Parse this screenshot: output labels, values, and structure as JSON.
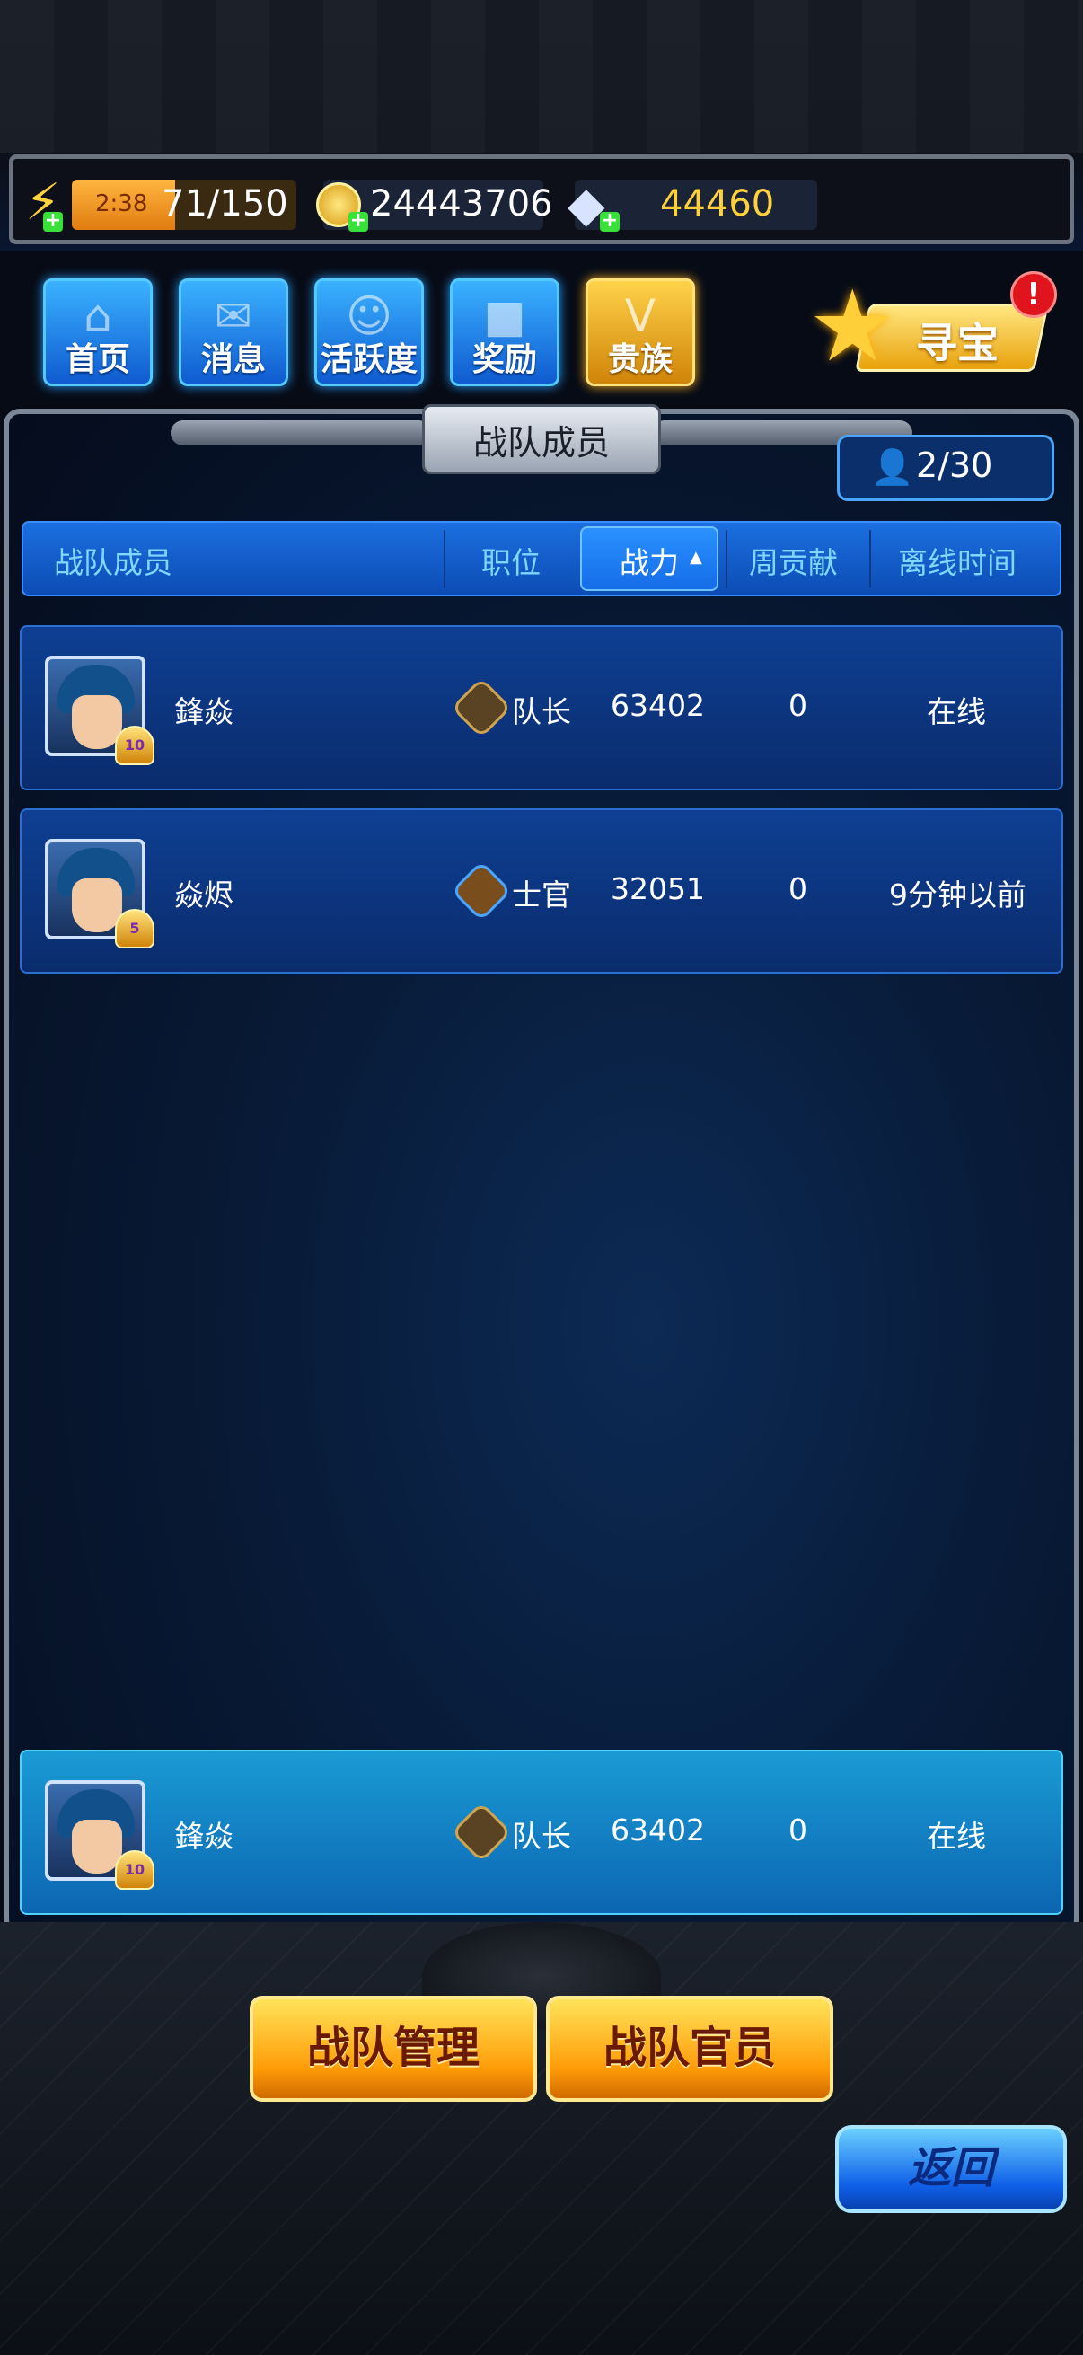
{
  "resources": {
    "energy_timer": "2:38",
    "energy": "71/150",
    "coins": "24443706",
    "gems": "44460"
  },
  "nav": [
    {
      "label": "首页",
      "icon": "home-icon"
    },
    {
      "label": "消息",
      "icon": "mail-icon"
    },
    {
      "label": "活跃度",
      "icon": "smile-icon"
    },
    {
      "label": "奖励",
      "icon": "gift-icon"
    },
    {
      "label": "贵族",
      "icon": "vip-crest-icon"
    }
  ],
  "treasure": {
    "label": "寻宝",
    "alert": "!"
  },
  "panel": {
    "title": "战队成员",
    "member_count": "2/30"
  },
  "table": {
    "headers": {
      "member": "战队成员",
      "position": "职位",
      "power": "战力",
      "contribution": "周贡献",
      "offline": "离线时间"
    },
    "sort_indicator": "▲",
    "rows": [
      {
        "name": "鋒焱",
        "vip": "10",
        "position": "队长",
        "power": "63402",
        "contribution": "0",
        "offline": "在线"
      },
      {
        "name": "焱烬",
        "vip": "5",
        "position": "士官",
        "power": "32051",
        "contribution": "0",
        "offline": "9分钟以前"
      }
    ],
    "self_row": {
      "name": "鋒焱",
      "vip": "10",
      "position": "队长",
      "power": "63402",
      "contribution": "0",
      "offline": "在线"
    }
  },
  "buttons": {
    "manage": "战队管理",
    "officers": "战队官员",
    "back": "返回"
  },
  "colors": {
    "accent_blue": "#1b6fe0",
    "gold": "#ffb020",
    "gem_text": "#ffd23b"
  }
}
